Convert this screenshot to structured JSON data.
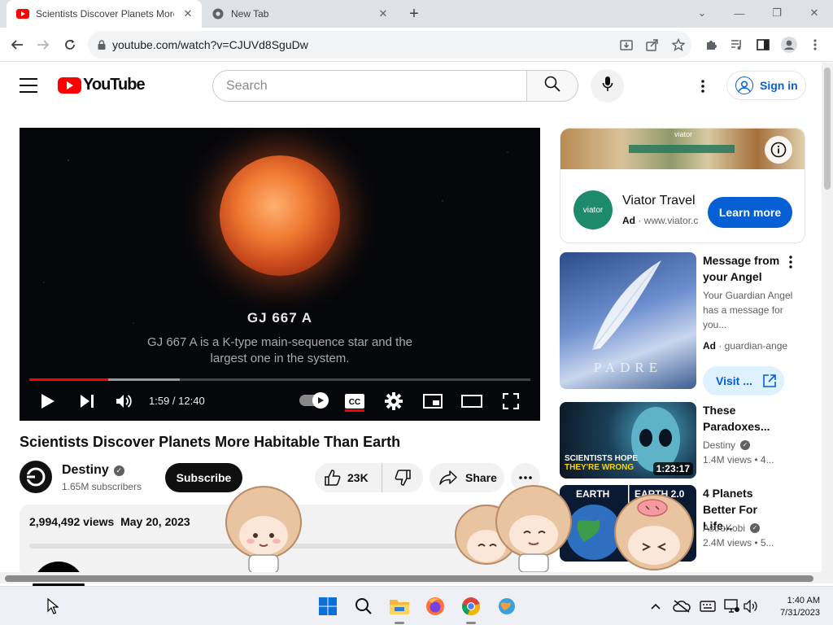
{
  "browser": {
    "tabs": [
      {
        "title": "Scientists Discover Planets More",
        "active": true
      },
      {
        "title": "New Tab",
        "active": false
      }
    ],
    "url": "youtube.com/watch?v=CJUVd8SguDw"
  },
  "masthead": {
    "logo_text": "YouTube",
    "search_placeholder": "Search",
    "sign_in": "Sign in"
  },
  "player": {
    "overlay_title": "GJ 667 A",
    "overlay_description": "GJ 667 A is a K-type main-sequence star and the largest one in the system.",
    "time": "1:59 / 12:40",
    "played_fraction": 0.157,
    "buffered_fraction": 0.3
  },
  "video": {
    "title": "Scientists Discover Planets More Habitable Than Earth",
    "channel": "Destiny",
    "subscribers": "1.65M subscribers",
    "subscribe_label": "Subscribe",
    "likes": "23K",
    "share_label": "Share",
    "views": "2,994,492 views",
    "date": "May 20, 2023"
  },
  "ad": {
    "banner_text": "viator",
    "logo_text": "viator",
    "name": "Viator Travel",
    "ad_label": "Ad",
    "domain": "www.viator.com",
    "cta": "Learn more"
  },
  "recommendations": [
    {
      "title": "Message from your Angel",
      "description": "Your Guardian Angel has a message for you...",
      "ad_label": "Ad",
      "domain": "guardian-angel",
      "cta": "Visit ...",
      "thumb_text": "PADRE"
    },
    {
      "title": "These Paradoxes...",
      "channel": "Destiny",
      "views": "1.4M views",
      "age": "4...",
      "duration": "1:23:17",
      "thumb_text_1": "SCIENTISTS HOPE",
      "thumb_text_2": "THEY'RE WRONG"
    },
    {
      "title": "4 Planets Better For Life...",
      "channel": "AstroKobi",
      "views": "2.4M views",
      "age": "5...",
      "thumb_text_1": "EARTH",
      "thumb_text_2": "EARTH 2.0"
    }
  ],
  "taskbar": {
    "time": "1:40 AM",
    "date": "7/31/2023"
  }
}
